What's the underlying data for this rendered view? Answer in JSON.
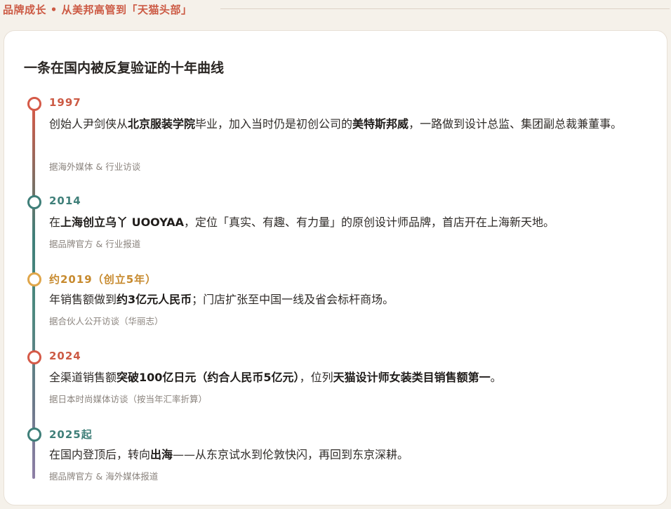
{
  "header": {
    "section_title": "品牌成长 • 从美邦高管到「天猫头部」"
  },
  "card": {
    "title": "一条在国内被反复验证的十年曲线"
  },
  "colors": {
    "red": "#d55a48",
    "teal": "#3f7f79",
    "amber": "#e0a64a",
    "amber_text": "#c78a2e",
    "red_text": "#cc5a44",
    "teal_text": "#3f7f79"
  },
  "events": [
    {
      "year": "1997",
      "segments": [
        {
          "t": "创始人尹剑侠从",
          "b": false
        },
        {
          "t": "北京服装学院",
          "b": true
        },
        {
          "t": "毕业，加入当时仍是初创公司的",
          "b": false
        },
        {
          "t": "美特斯邦威",
          "b": true
        },
        {
          "t": "，一路做到设计总监、集团副总裁兼董事。",
          "b": false
        }
      ],
      "source": "据海外媒体 & 行业访谈"
    },
    {
      "year": "2014",
      "segments": [
        {
          "t": "在",
          "b": false
        },
        {
          "t": "上海创立乌丫 UOOYAA",
          "b": true
        },
        {
          "t": "，定位「真实、有趣、有力量」的原创设计师品牌，首店开在上海新天地。",
          "b": false
        }
      ],
      "source": "据品牌官方 & 行业报道"
    },
    {
      "year": "约2019（创立5年）",
      "segments": [
        {
          "t": "年销售额做到",
          "b": false
        },
        {
          "t": "约3亿元人民币",
          "b": true
        },
        {
          "t": "；门店扩张至中国一线及省会标杆商场。",
          "b": false
        }
      ],
      "source": "据合伙人公开访谈（华丽志）"
    },
    {
      "year": "2024",
      "segments": [
        {
          "t": "全渠道销售额",
          "b": false
        },
        {
          "t": "突破100亿日元（约合人民币5亿元）",
          "b": true
        },
        {
          "t": "，位列",
          "b": false
        },
        {
          "t": "天猫设计师女装类目销售额第一",
          "b": true
        },
        {
          "t": "。",
          "b": false
        }
      ],
      "source": "据日本时尚媒体访谈（按当年汇率折算）"
    },
    {
      "year": "2025起",
      "segments": [
        {
          "t": "在国内登顶后，转向",
          "b": false
        },
        {
          "t": "出海",
          "b": true
        },
        {
          "t": "——从东京试水到伦敦快闪，再回到东京深耕。",
          "b": false
        }
      ],
      "source": "据品牌官方 & 海外媒体报道"
    }
  ]
}
